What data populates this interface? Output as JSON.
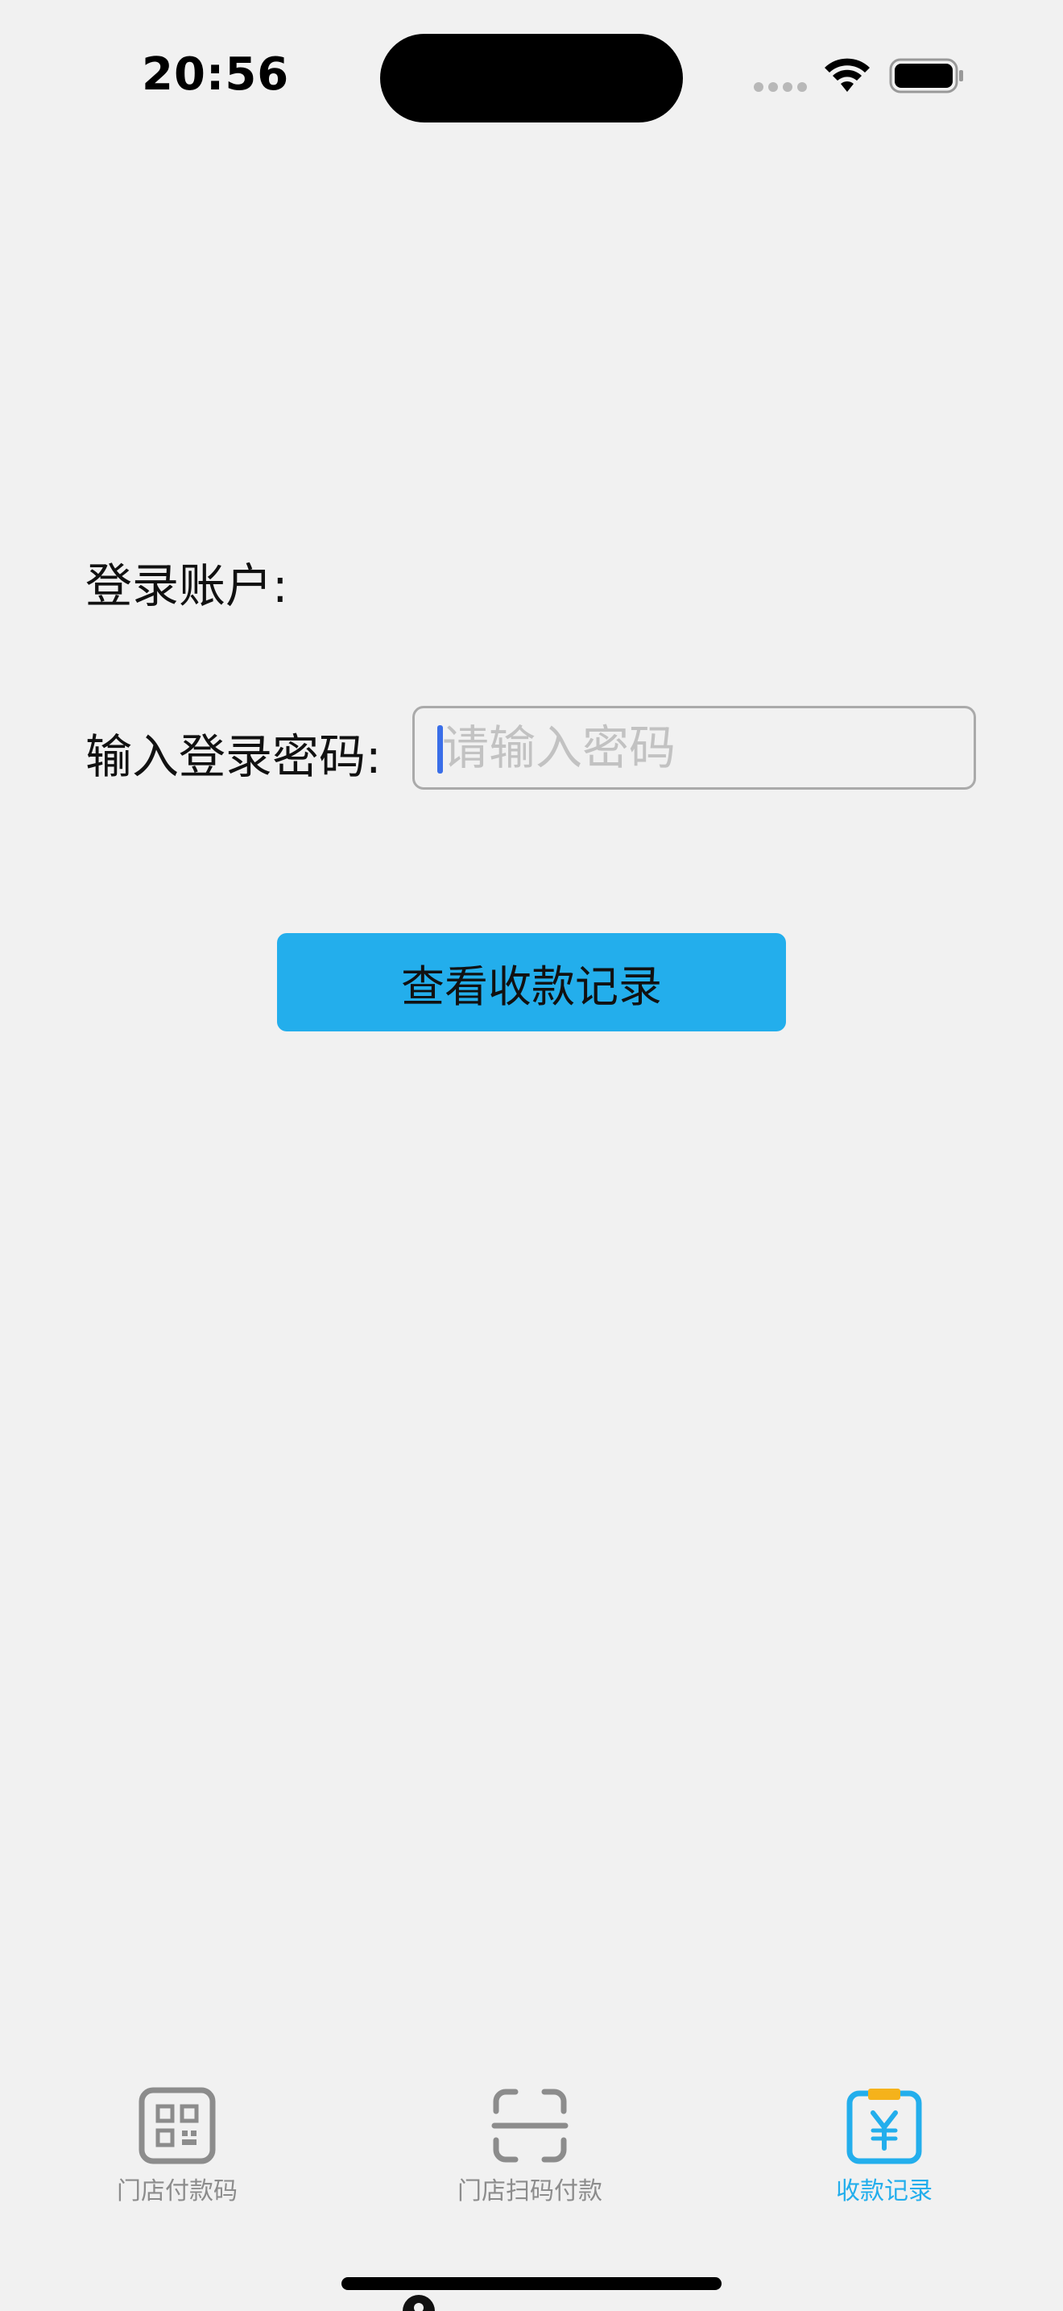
{
  "status_bar": {
    "time": "20:56",
    "icons": [
      "cellular-signal-icon",
      "wifi-icon",
      "battery-icon"
    ]
  },
  "form": {
    "account_label": "登录账户:",
    "password_label": "输入登录密码:",
    "password_value": "",
    "password_placeholder": "请输入密码",
    "submit_label": "查看收款记录"
  },
  "tabs": [
    {
      "label": "门店付款码",
      "icon": "qr-code-icon",
      "active": false
    },
    {
      "label": "门店扫码付款",
      "icon": "scan-icon",
      "active": false
    },
    {
      "label": "收款记录",
      "icon": "receipt-yen-icon",
      "active": true
    }
  ],
  "colors": {
    "accent": "#23aeec",
    "background": "#f1f1f1",
    "inactive_tab": "#8c8c8c",
    "icon_badge": "#f5b21b"
  }
}
